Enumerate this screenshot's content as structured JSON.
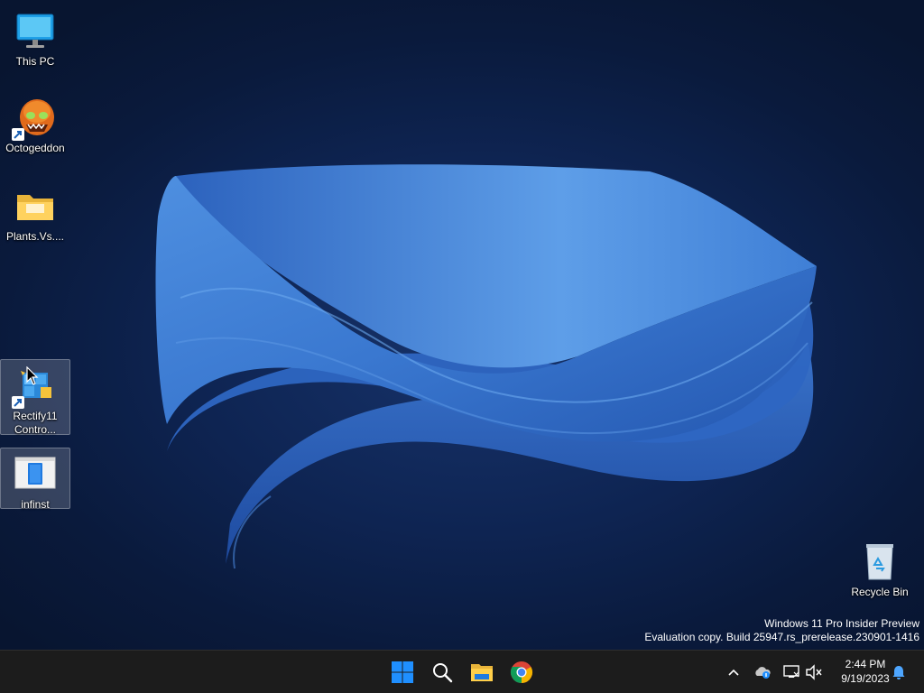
{
  "desktop": {
    "icons": [
      {
        "label": "This PC",
        "icon": "monitor-icon"
      },
      {
        "label": "Octogeddon",
        "icon": "octogeddon-game-icon"
      },
      {
        "label": "Plants.Vs....",
        "icon": "folder-icon"
      },
      {
        "label": "Rectify11 Contro...",
        "icon": "rectify11-control-panel-icon",
        "selected": true
      },
      {
        "label": "infinst",
        "icon": "infinst-app-icon",
        "selected": true
      },
      {
        "label": "Recycle Bin",
        "icon": "recycle-bin-icon"
      }
    ]
  },
  "watermark": {
    "line1": "Windows 11 Pro Insider Preview",
    "line2": "Evaluation copy. Build 25947.rs_prerelease.230901-1416"
  },
  "taskbar": {
    "apps": [
      "start-icon",
      "search-icon",
      "file-explorer-icon",
      "chrome-icon"
    ],
    "tray": [
      "chevron-up-icon",
      "onedrive-icon",
      "network-icon",
      "volume-muted-icon",
      "notification-bell-icon"
    ],
    "clock": {
      "time": "2:44 PM",
      "date": "9/19/2023"
    }
  },
  "colors": {
    "wallpaper_bg": "#0e2452",
    "bloom": "#3a78d0",
    "taskbar_bg": "#1c1c1c",
    "start_blue": "#1f8fff"
  }
}
